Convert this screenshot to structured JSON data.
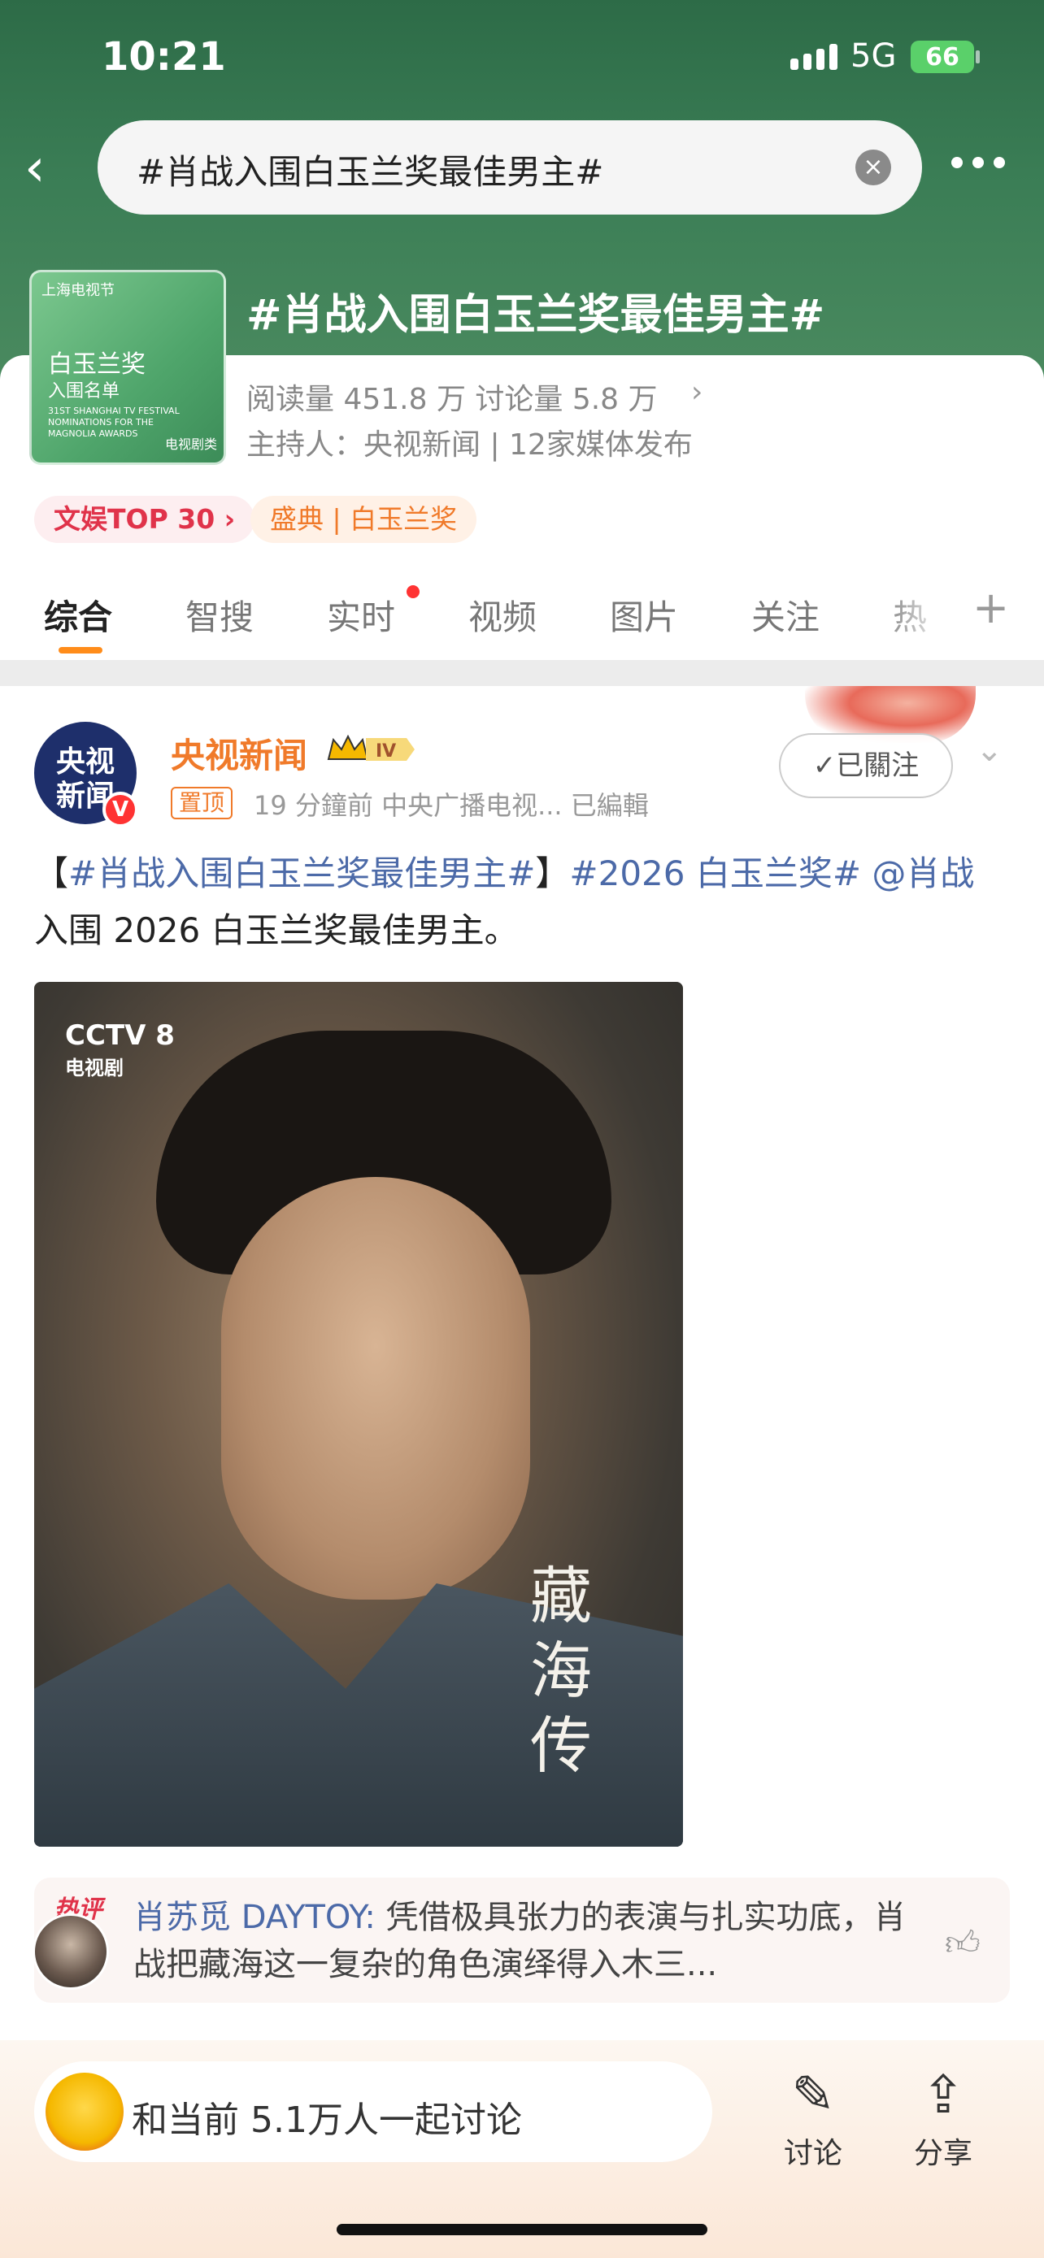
{
  "status_bar": {
    "time": "10:21",
    "network": "5G",
    "battery": "66"
  },
  "search": {
    "query": "#肖战入围白玉兰奖最佳男主#"
  },
  "topic": {
    "title": "#肖战入围白玉兰奖最佳男主#",
    "stats": "阅读量 451.8 万  讨论量 5.8 万",
    "host": "主持人：央视新闻 | 12家媒体发布",
    "cover": {
      "logo_text": "上海电视节",
      "title": "白玉兰奖",
      "subtitle": "入围名单",
      "english": "31ST SHANGHAI TV FESTIVAL NOMINATIONS FOR THE MAGNOLIA AWARDS",
      "corner": "电视剧类"
    }
  },
  "tags": {
    "top": "文娱TOP 30 ›",
    "event": "盛典 | 白玉兰奖"
  },
  "tabs": [
    "综合",
    "智搜",
    "实时",
    "视频",
    "图片",
    "关注",
    "热"
  ],
  "post": {
    "author": "央视新闻",
    "avatar_line1": "央视",
    "avatar_line2": "新闻",
    "level": "IV",
    "pinned": "置顶",
    "meta": "19 分鐘前   中央广播电视...   已編輯",
    "follow": "✓已關注",
    "text_prefix": "【",
    "text_link1": "#肖战入围白玉兰奖最佳男主#",
    "text_mid": "】",
    "text_link2": "#2026 白玉兰奖# @肖战",
    "text_suffix": " 入围 2026 白玉兰奖最佳男主。",
    "image": {
      "channel": "CCTV 8",
      "channel_sub": "电视剧",
      "calligraphy": "藏海传"
    }
  },
  "hot_comment": {
    "tag": "热评",
    "name": "肖苏觅 DAYTOY:",
    "text": " 凭借极具张力的表演与扎实功底，肖战把藏海这一复杂的角色演绎得入木三..."
  },
  "bottom_bar": {
    "discuss_prompt": "和当前 5.1万人一起讨论",
    "discuss_label": "讨论",
    "share_label": "分享"
  },
  "colors": {
    "accent": "#f07a2a",
    "header_green": "#3a7d55",
    "link": "#4c6aa8",
    "tab_underline": "#ff8c1a"
  }
}
